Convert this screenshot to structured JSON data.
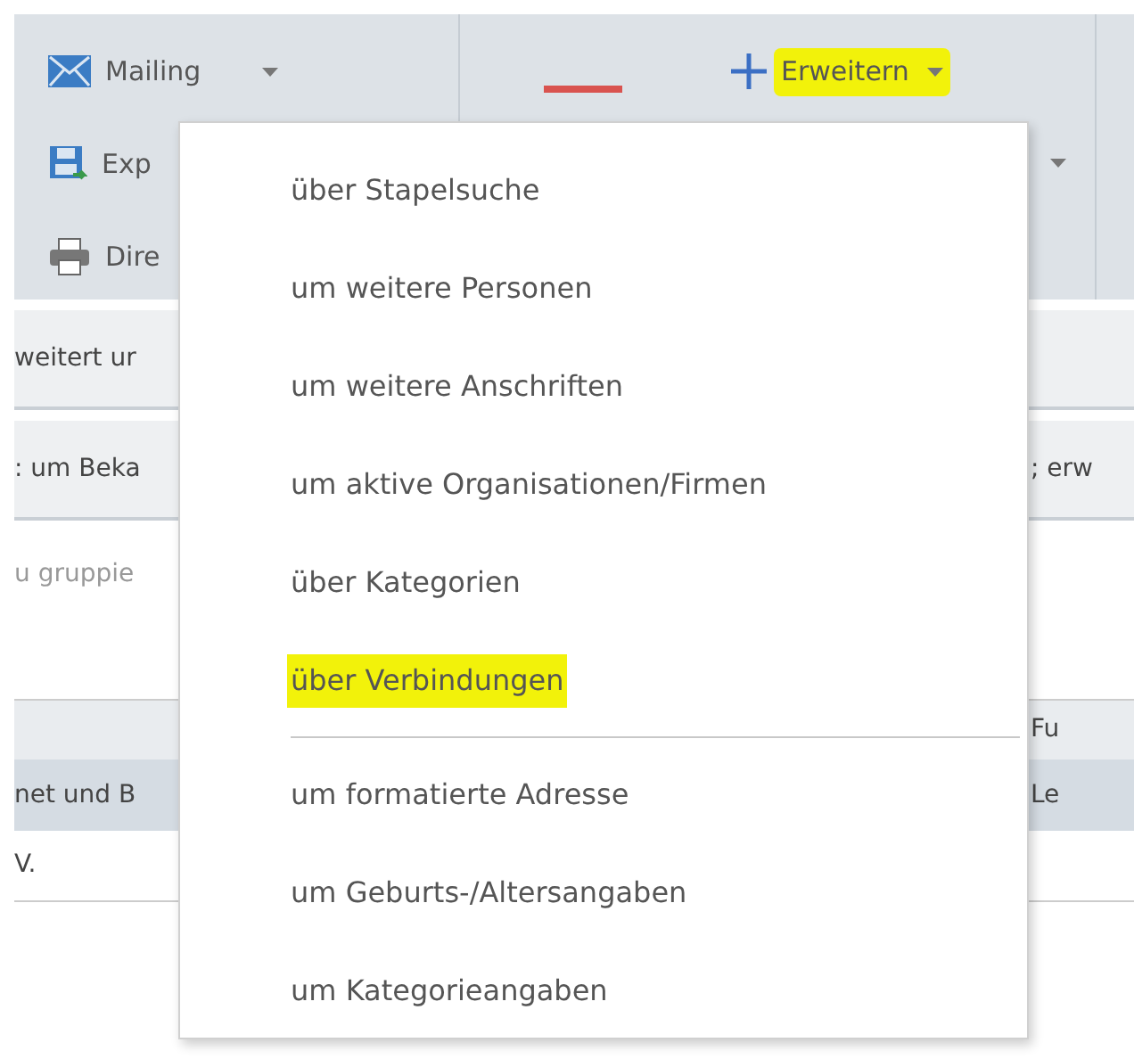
{
  "ribbon": {
    "left_items": [
      {
        "kind": "mail",
        "label": "Mailing",
        "dropdown": true
      },
      {
        "kind": "save",
        "label": "Exp",
        "dropdown": false
      },
      {
        "kind": "print",
        "label": "Dire",
        "dropdown": false
      }
    ],
    "expand_button": {
      "label": "Erweitern",
      "highlighted": true
    }
  },
  "background_rows": [
    {
      "kind": "band",
      "left": "weitert ur"
    },
    {
      "kind": "band",
      "left": ": um Beka",
      "right": "; erw"
    },
    {
      "kind": "hint",
      "left": "u gruppie"
    },
    {
      "kind": "header",
      "right": "Fu"
    },
    {
      "kind": "selected",
      "left": "net und B",
      "right": "Le"
    },
    {
      "kind": "plain",
      "left": "V."
    }
  ],
  "menu": {
    "groups": [
      [
        {
          "label": "über Stapelsuche",
          "highlighted": false
        },
        {
          "label": "um weitere Personen",
          "highlighted": false
        },
        {
          "label": "um weitere Anschriften",
          "highlighted": false
        },
        {
          "label": "um aktive Organisationen/Firmen",
          "highlighted": false
        },
        {
          "label": "über Kategorien",
          "highlighted": false
        },
        {
          "label": "über Verbindungen",
          "highlighted": true
        }
      ],
      [
        {
          "label": "um formatierte Adresse",
          "highlighted": false
        },
        {
          "label": "um Geburts-/Altersangaben",
          "highlighted": false
        },
        {
          "label": "um Kategorieangaben",
          "highlighted": false
        }
      ]
    ]
  }
}
